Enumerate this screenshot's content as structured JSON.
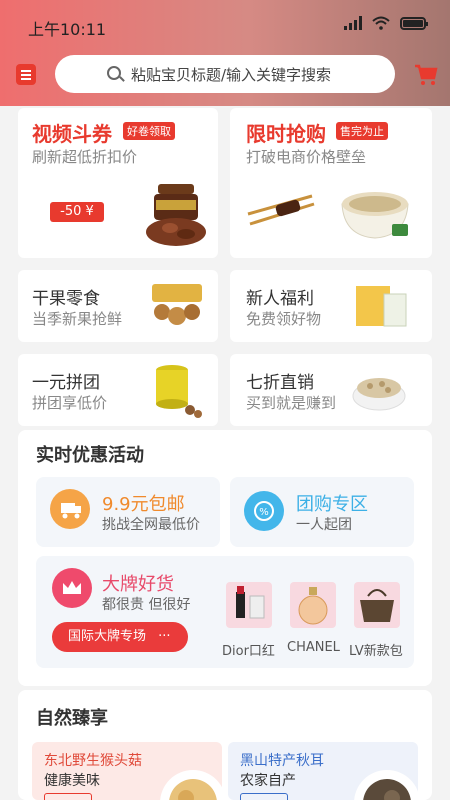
{
  "status_bar": {
    "time": "上午10:11"
  },
  "search": {
    "placeholder": "粘贴宝贝标题/输入关键字搜索"
  },
  "promo_cards": {
    "video": {
      "title": "视频斗券",
      "tag": "好卷领取",
      "subtitle": "刷新超低折扣价",
      "price_tag": "-50 ¥"
    },
    "flash": {
      "title": "限时抢购",
      "tag": "售完为止",
      "subtitle": "打破电商价格壁垒"
    }
  },
  "category_cards": [
    {
      "title": "干果零食",
      "subtitle": "当季新果抢鲜"
    },
    {
      "title": "新人福利",
      "subtitle": "免费领好物"
    },
    {
      "title": "一元拼团",
      "subtitle": "拼团享低价"
    },
    {
      "title": "七折直销",
      "subtitle": "买到就是赚到"
    }
  ],
  "realtime": {
    "title": "实时优惠活动",
    "shipping": {
      "title": "9.9元包邮",
      "subtitle": "挑战全网最低价"
    },
    "group": {
      "title": "团购专区",
      "subtitle": "一人起团"
    },
    "brand": {
      "title": "大牌好货",
      "subtitle": "都很贵 但很好",
      "button": "国际大牌专场",
      "button_more": "···",
      "items": [
        "Dior口红",
        "CHANEL",
        "LV新款包"
      ]
    }
  },
  "natural": {
    "title": "自然臻享",
    "cards": [
      {
        "title": "东北野生猴头菇",
        "subtitle": "健康美味"
      },
      {
        "title": "黑山特产秋耳",
        "subtitle": "农家自产"
      }
    ]
  },
  "colors": {
    "accent": "#e83a2e",
    "orange": "#f08a2c",
    "blue": "#3cb0e6",
    "pink": "#e84a6a"
  }
}
